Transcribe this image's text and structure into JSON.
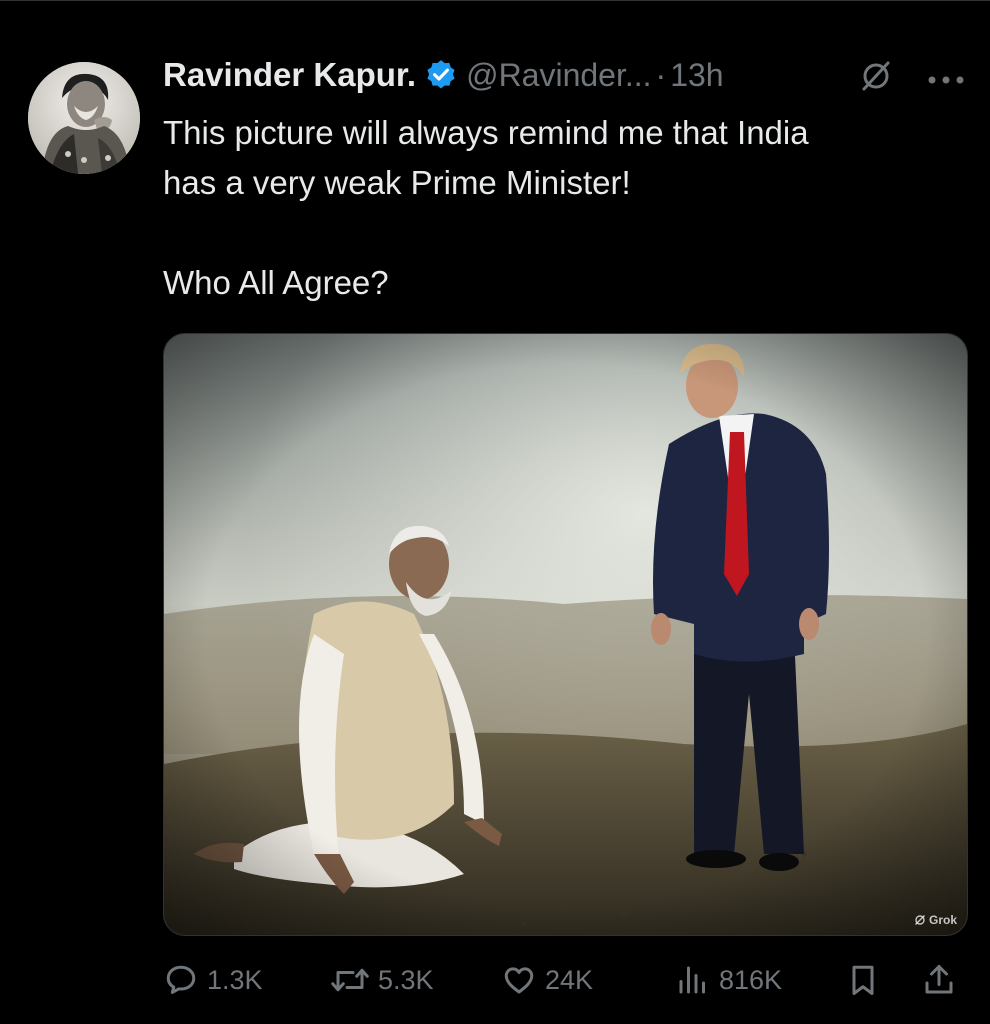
{
  "tweet": {
    "author_name": "Ravinder Kapur.",
    "handle": "@Ravinder...",
    "separator": "·",
    "time": "13h",
    "text": "This picture will always remind me that India\nhas a very weak Prime Minister!\n\nWho All Agree?",
    "media_watermark": "Grok"
  },
  "actions": {
    "replies": "1.3K",
    "reposts": "5.3K",
    "likes": "24K",
    "views": "816K"
  },
  "icons": {
    "verified": "verified-badge-icon",
    "grok": "grok-icon",
    "more": "more-icon",
    "reply": "reply-icon",
    "repost": "repost-icon",
    "like": "like-icon",
    "views": "views-icon",
    "bookmark": "bookmark-icon",
    "share": "share-icon"
  },
  "colors": {
    "background": "#000000",
    "text": "#e7e9ea",
    "secondary_text": "#71767b",
    "verified": "#1d9bf0"
  }
}
